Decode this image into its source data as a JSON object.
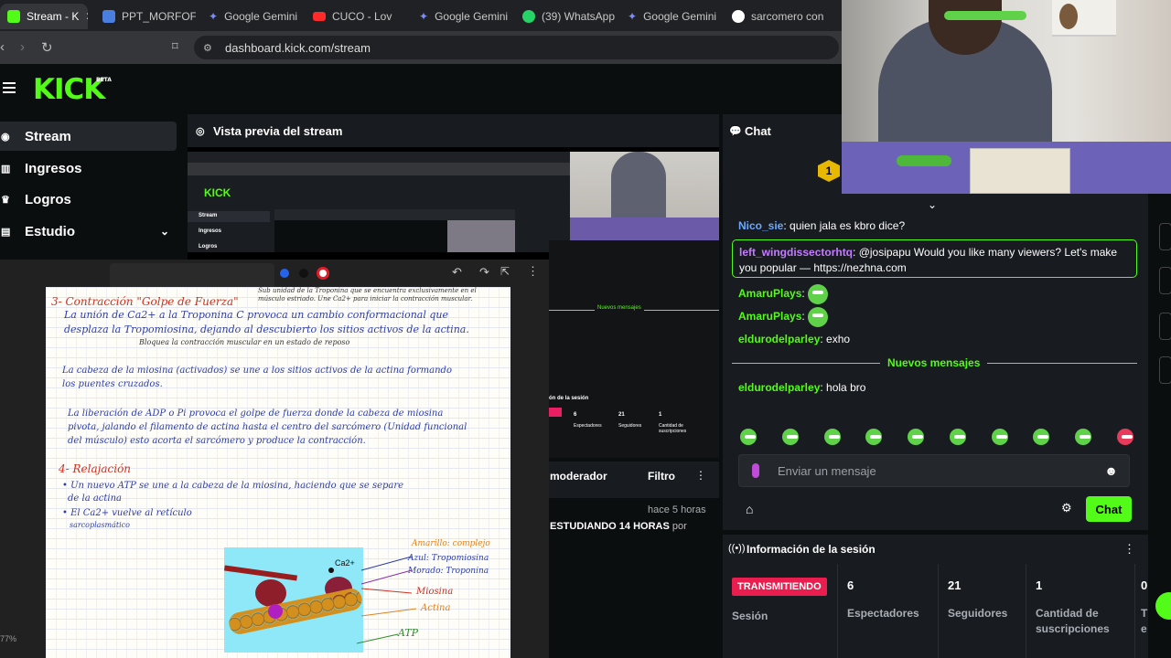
{
  "browser": {
    "tabs": [
      {
        "label": "Stream - K",
        "color": "#53fc18"
      },
      {
        "label": "PPT_MORFOFIS",
        "color": "#4a7fe0"
      },
      {
        "label": "Google Gemini",
        "color": "#7b8cff"
      },
      {
        "label": "CUCO - Lov",
        "color": "#ff2a2a"
      },
      {
        "label": "Google Gemini",
        "color": "#7b8cff"
      },
      {
        "label": "(39) WhatsApp",
        "color": "#25d366"
      },
      {
        "label": "Google Gemini",
        "color": "#7b8cff"
      },
      {
        "label": "sarcomero con",
        "color": "#ffffff"
      }
    ],
    "url": "dashboard.kick.com/stream"
  },
  "kick": {
    "logo": "KICK",
    "beta": "BETA"
  },
  "sidebar": {
    "items": [
      {
        "label": "Stream",
        "icon": "stream-icon"
      },
      {
        "label": "Ingresos",
        "icon": "chart-icon"
      },
      {
        "label": "Logros",
        "icon": "trophy-icon"
      },
      {
        "label": "Estudio",
        "icon": "studio-icon"
      }
    ]
  },
  "preview": {
    "title": "Vista previa del stream",
    "mini": {
      "chat_label": "Chat",
      "nav": [
        "Stream",
        "Ingresos",
        "Logros"
      ],
      "new_msgs": "Nuevos mensajes",
      "session_title": "ón de la sesión",
      "stats": [
        {
          "num": "6",
          "label": "Espectadores"
        },
        {
          "num": "21",
          "label": "Seguidores"
        },
        {
          "num": "1",
          "label": "Cantidad de suscripciones"
        }
      ]
    }
  },
  "moderator": {
    "title": "moderador",
    "filter": "Filtro",
    "time": "hace 5 horas",
    "text_bold": "ESTUDIANDO 14 HORAS",
    "text_tail": "por"
  },
  "notes": {
    "zoom": "77%",
    "lines": [
      "3- Contracción \"Golpe de Fuerza\"",
      "Sub unidad de la Troponina que se encuentra exclusivamente en el músculo estriado. Une Ca2+ para iniciar la contracción muscular.",
      "La unión de Ca2+ a la Troponina C provoca un cambio conformacional que",
      "desplaza la Tropomiosina, dejando al descubierto los sitios activos de la actina.",
      "Bloquea la contracción muscular en un estado de reposo",
      "La cabeza de la miosina (activados) se une a los sitios activos de la actina formando",
      "los puentes cruzados.",
      "La liberación de ADP o Pi provoca el golpe de fuerza donde la cabeza de miosina",
      "pivota, jalando el filamento de actina hasta el centro del sarcómero (Unidad funcional",
      "del músculo) esto acorta el sarcómero y produce la contracción.",
      "4- Relajación",
      "• Un nuevo ATP se une a la cabeza de la miosina, haciendo que se separe",
      "de la actina",
      "• El Ca2+ vuelve al retículo",
      "sarcoplasmático"
    ],
    "diagram_labels": [
      "Ca2+",
      "Amarillo: complejo",
      "Azul: Tropomiosina",
      "Morado: Troponina",
      "Miosina",
      "Actina",
      "ATP"
    ]
  },
  "chat": {
    "title": "Chat",
    "pinned_count": "1",
    "messages": [
      {
        "user": "Nico_sie",
        "color": "#6aa8ff",
        "text": "quien jala es kbro dice?"
      },
      {
        "user": "left_wingdissectorhtq",
        "color": "#c47cff",
        "text": "@josipapu Would you like many viewers? Let's make",
        "text2": "you popular — https://nezhna.com"
      },
      {
        "user": "AmaruPlays",
        "color": "#53fc18",
        "text": ""
      },
      {
        "user": "AmaruPlays",
        "color": "#53fc18",
        "text": ""
      },
      {
        "user": "eldurodelparley",
        "color": "#53fc18",
        "text": "exho"
      },
      {
        "user": "eldurodelparley",
        "color": "#53fc18",
        "text": "hola bro"
      }
    ],
    "new_messages": "Nuevos mensajes",
    "input_placeholder": "Enviar un mensaje",
    "send_label": "Chat"
  },
  "session": {
    "title": "Información de la sesión",
    "live_badge": "TRANSMITIENDO",
    "session_label": "Sesión",
    "stats": [
      {
        "num": "6",
        "label": "Espectadores"
      },
      {
        "num": "21",
        "label": "Seguidores"
      },
      {
        "num": "1",
        "label": "Cantidad de suscripciones"
      },
      {
        "num": "0",
        "label": "T e"
      }
    ]
  }
}
